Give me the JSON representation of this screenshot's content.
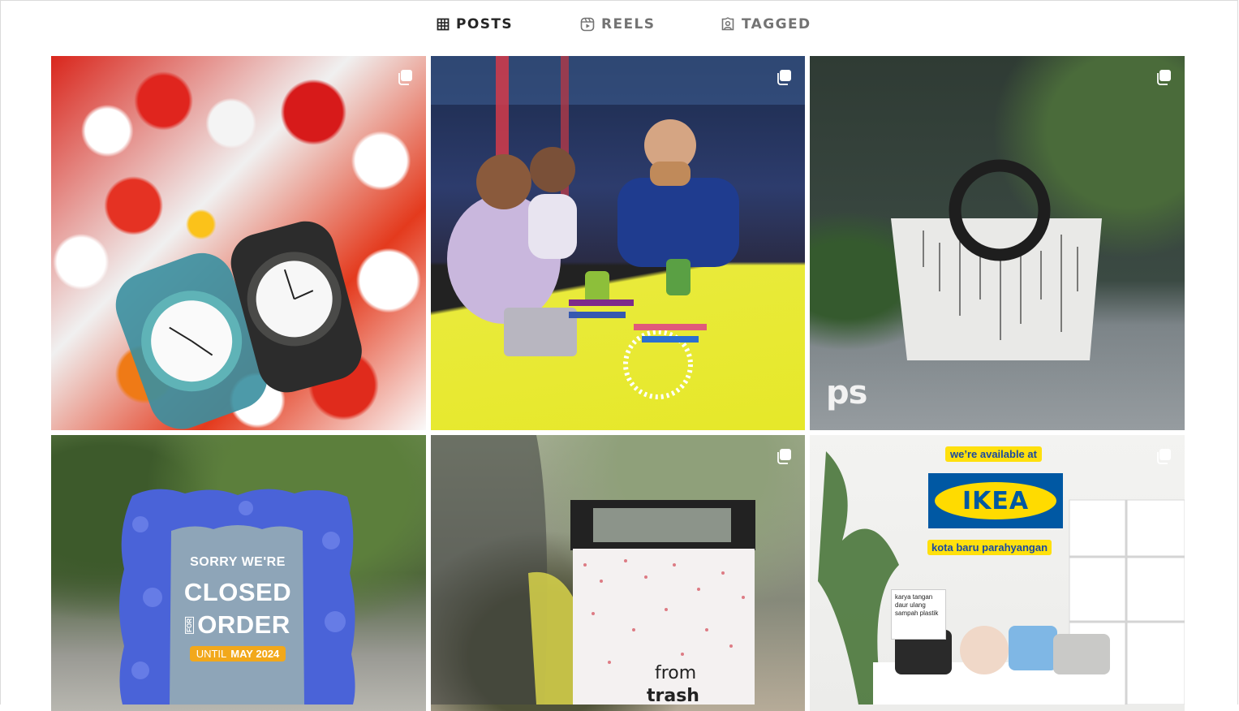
{
  "tabs": [
    {
      "label": "POSTS",
      "icon": "grid-icon",
      "active": true
    },
    {
      "label": "REELS",
      "icon": "reels-icon",
      "active": false
    },
    {
      "label": "TAGGED",
      "icon": "tagged-icon",
      "active": false
    }
  ],
  "posts": [
    {
      "overlay_text": [],
      "multi": true
    },
    {
      "overlay_text": [],
      "multi": true
    },
    {
      "overlay_text": [
        "ps"
      ],
      "multi": true
    },
    {
      "overlay_text": [
        "SORRY WE'RE",
        "CLOSED",
        "FOR",
        "ORDER",
        "UNTIL",
        "MAY 2024"
      ],
      "multi": false
    },
    {
      "overlay_text": [
        "from",
        "trash"
      ],
      "multi": true
    },
    {
      "overlay_text": [
        "we’re available at",
        "IKEA",
        "kota baru parahyangan",
        "karya tangan daur ulang sampah plastik"
      ],
      "multi": true
    }
  ],
  "colors": {
    "active_tab": "#262626",
    "inactive_tab": "#737373",
    "border": "#dbdbdb"
  }
}
